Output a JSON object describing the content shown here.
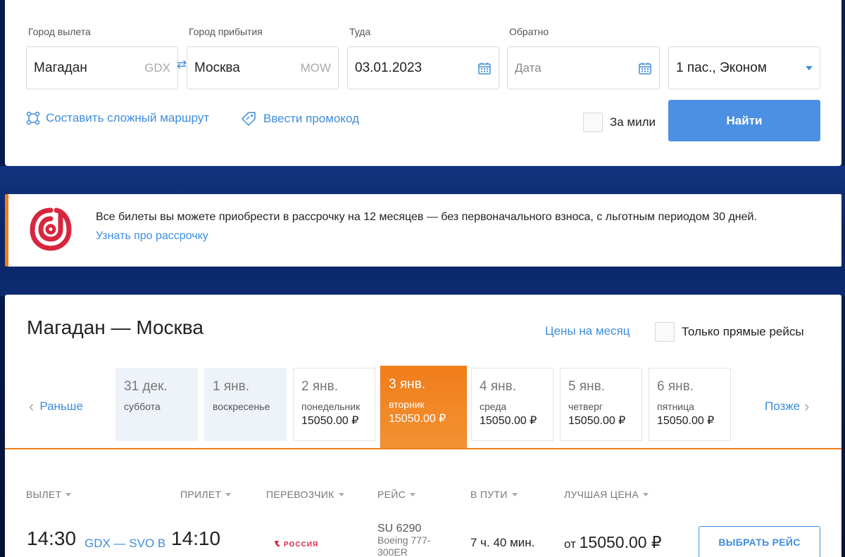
{
  "search": {
    "from_label": "Город вылета",
    "from_value": "Магадан",
    "from_code": "GDX",
    "to_label": "Город прибытия",
    "to_value": "Москва",
    "to_code": "MOW",
    "depart_label": "Туда",
    "depart_value": "03.01.2023",
    "return_label": "Обратно",
    "return_placeholder": "Дата",
    "passengers_value": "1 пас., Эконом",
    "complex_route_link": "Составить сложный маршрут",
    "promo_link": "Ввести промокод",
    "miles_label": "За мили",
    "find_button": "Найти"
  },
  "banner": {
    "text": "Все билеты вы можете приобрести в рассрочку на 12 месяцев — без первоначального взноса, с льготным периодом 30 дней.",
    "link": "Узнать про рассрочку",
    "accent_color": "#f07d1a"
  },
  "results": {
    "route_title": "Магадан — Москва",
    "month_prices_link": "Цены на месяц",
    "direct_only_label": "Только прямые рейсы",
    "prev_label": "Раньше",
    "next_label": "Позже",
    "days": [
      {
        "date": "31 дек.",
        "weekday": "суббота",
        "price": ""
      },
      {
        "date": "1 янв.",
        "weekday": "воскресенье",
        "price": ""
      },
      {
        "date": "2 янв.",
        "weekday": "понедельник",
        "price": "15050.00 ₽"
      },
      {
        "date": "3 янв.",
        "weekday": "вторник",
        "price": "15050.00 ₽"
      },
      {
        "date": "4 янв.",
        "weekday": "среда",
        "price": "15050.00 ₽"
      },
      {
        "date": "5 янв.",
        "weekday": "четверг",
        "price": "15050.00 ₽"
      },
      {
        "date": "6 янв.",
        "weekday": "пятница",
        "price": "15050.00 ₽"
      }
    ],
    "columns": {
      "departure": "ВЫЛЕТ",
      "arrival": "ПРИЛЕТ",
      "carrier": "ПЕРЕВОЗЧИК",
      "flight": "РЕЙС",
      "duration": "В ПУТИ",
      "best_price": "ЛУЧШАЯ ЦЕНА"
    },
    "flights": [
      {
        "depart_time": "14:30",
        "route_codes": "GDX — SVO B",
        "arrive_time": "14:10",
        "carrier_name": "РОССИЯ",
        "flight_number": "SU 6290",
        "aircraft": "Boeing 777-300ER",
        "duration": "7 ч. 40 мин.",
        "price_prefix": "от",
        "price": "15050.00 ₽",
        "choose_button": "ВЫБРАТЬ РЕЙС"
      }
    ]
  },
  "colors": {
    "accent_blue": "#3e8ddd",
    "button_blue": "#4b90e2",
    "accent_orange": "#f07d1a"
  }
}
